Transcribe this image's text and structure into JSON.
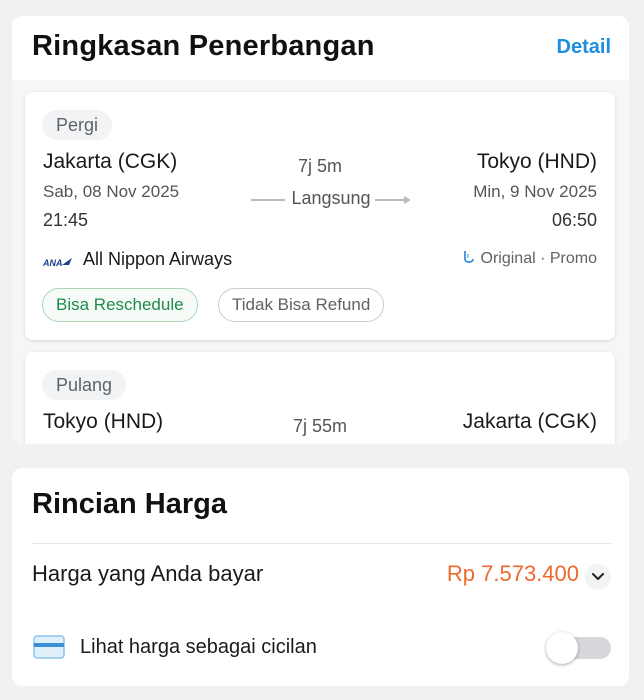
{
  "summary": {
    "title": "Ringkasan Penerbangan",
    "detail_label": "Detail"
  },
  "outbound": {
    "direction_label": "Pergi",
    "origin_city": "Jakarta (CGK)",
    "origin_date": "Sab, 08 Nov 2025",
    "origin_time": "21:45",
    "duration": "7j 5m",
    "stops": "Langsung",
    "dest_city": "Tokyo (HND)",
    "dest_date": "Min, 9 Nov 2025",
    "dest_time": "06:50",
    "airline_logo_text": "ANA",
    "airline_name": "All Nippon Airways",
    "fare_type": "Original · Promo",
    "tags": [
      "Bisa Reschedule",
      "Tidak Bisa Refund"
    ]
  },
  "return": {
    "direction_label": "Pulang",
    "origin_city": "Tokyo (HND)",
    "duration": "7j 55m",
    "dest_city": "Jakarta (CGK)"
  },
  "price": {
    "title": "Rincian Harga",
    "total_label": "Harga yang Anda bayar",
    "total_value": "Rp 7.573.400",
    "installment_label": "Lihat harga sebagai cicilan",
    "installment_enabled": false
  },
  "colors": {
    "accent_blue": "#1e8fe1",
    "price_orange": "#ee6a2c",
    "tag_green": "#1f8a4c"
  },
  "icons": {
    "expand": "chevron-down-icon",
    "card": "credit-card-icon",
    "fare": "fare-class-icon"
  }
}
